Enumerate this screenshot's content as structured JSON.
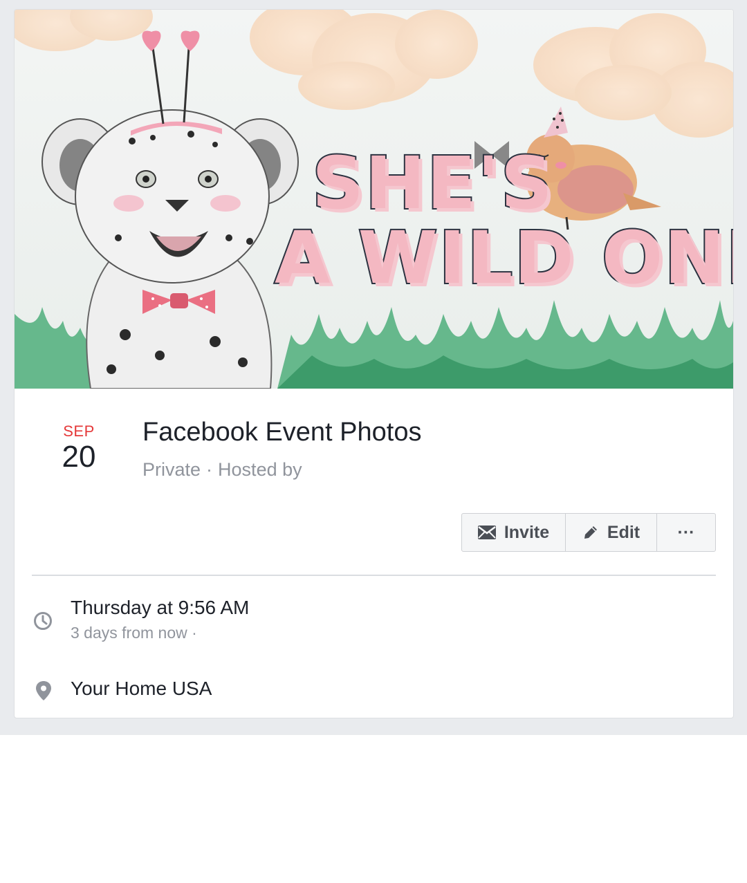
{
  "cover": {
    "line1": "SHE'S",
    "line2": "A WILD ONE"
  },
  "event": {
    "month": "SEP",
    "day": "20",
    "title": "Facebook Event Photos",
    "privacy": "Private",
    "separator": "·",
    "hosted_by": "Hosted by"
  },
  "actions": {
    "invite_label": "Invite",
    "edit_label": "Edit",
    "more_label": "···"
  },
  "details": {
    "time_main": "Thursday at 9:56 AM",
    "time_sub": "3 days from now ·",
    "location": "Your Home USA"
  },
  "icons": {
    "invite": "envelope-icon",
    "edit": "pencil-icon",
    "time": "clock-icon",
    "location": "map-pin-icon"
  },
  "colors": {
    "month_red": "#e5393a",
    "text_dark": "#1d2129",
    "text_muted": "#90949c",
    "page_background": "#e9ebee",
    "title_pink": "#f4b8c2"
  }
}
